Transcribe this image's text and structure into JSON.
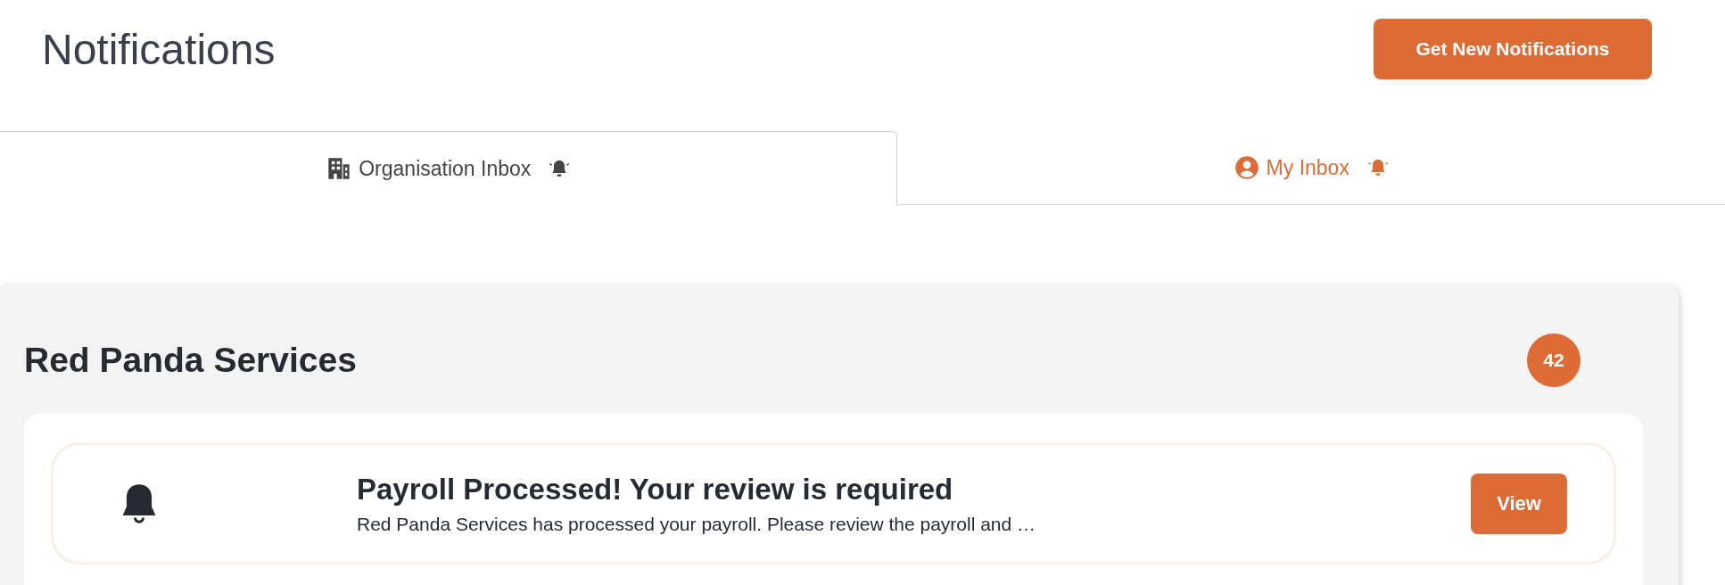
{
  "page": {
    "title": "Notifications"
  },
  "header_button": {
    "label": "Get New Notifications"
  },
  "tabs": [
    {
      "label": "Organisation Inbox",
      "kind": "organisation",
      "selected": true
    },
    {
      "label": "My Inbox",
      "kind": "personal",
      "selected": false
    }
  ],
  "group": {
    "title": "Red Panda Services",
    "count": "42"
  },
  "notifications": [
    {
      "title": "Payroll Processed! Your review is required",
      "description": "Red Panda Services has processed your payroll. Please review the payroll and …",
      "button": "View"
    }
  ]
}
